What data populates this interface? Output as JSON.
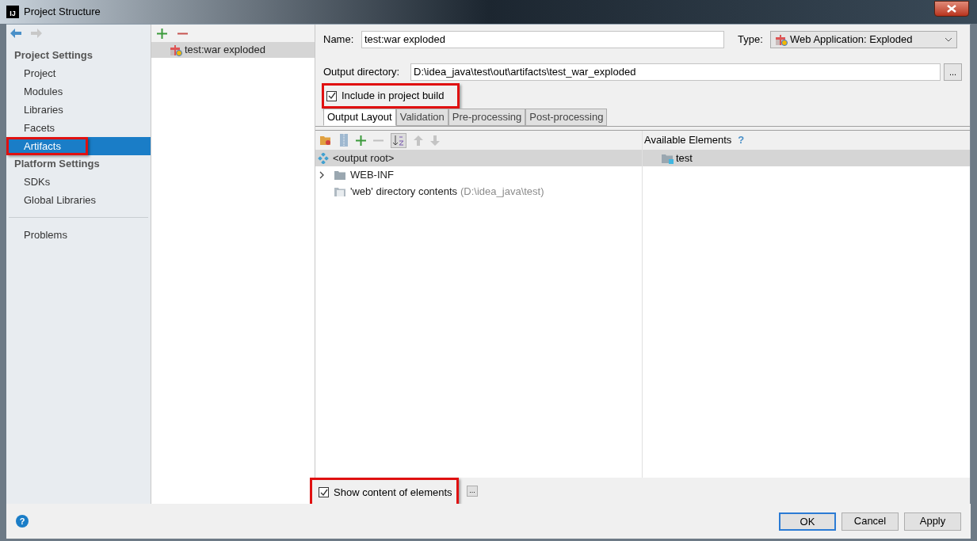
{
  "window": {
    "logo": "IJ",
    "title": "Project Structure"
  },
  "sidebar": {
    "sections": [
      {
        "title": "Project Settings",
        "items": [
          {
            "label": "Project",
            "selected": false,
            "highlighted": false
          },
          {
            "label": "Modules",
            "selected": false,
            "highlighted": false
          },
          {
            "label": "Libraries",
            "selected": false,
            "highlighted": false
          },
          {
            "label": "Facets",
            "selected": false,
            "highlighted": false
          },
          {
            "label": "Artifacts",
            "selected": true,
            "highlighted": true
          }
        ]
      },
      {
        "title": "Platform Settings",
        "items": [
          {
            "label": "SDKs",
            "selected": false,
            "highlighted": false
          },
          {
            "label": "Global Libraries",
            "selected": false,
            "highlighted": false
          }
        ]
      },
      {
        "items": [
          {
            "label": "Problems",
            "selected": false,
            "highlighted": false
          }
        ]
      }
    ]
  },
  "artifacts": [
    {
      "label": "test:war exploded",
      "selected": true
    }
  ],
  "form": {
    "name_label": "Name:",
    "name_value": "test:war exploded",
    "type_label": "Type:",
    "type_value": "Web Application: Exploded",
    "output_label": "Output directory:",
    "output_value": "D:\\idea_java\\test\\out\\artifacts\\test_war_exploded",
    "browse": "...",
    "include": {
      "label": "Include in project build",
      "checked": true,
      "highlighted": true
    }
  },
  "tabs": [
    {
      "label": "Output Layout",
      "selected": true
    },
    {
      "label": "Validation",
      "selected": false
    },
    {
      "label": "Pre-processing",
      "selected": false
    },
    {
      "label": "Post-processing",
      "selected": false
    }
  ],
  "layout_tree": [
    {
      "kind": "root",
      "label": "<output root>",
      "selected": true,
      "children": [
        {
          "kind": "folder",
          "label": "WEB-INF",
          "expanded": false,
          "selected": false
        },
        {
          "kind": "contents",
          "label": "'web' directory contents",
          "detail": "(D:\\idea_java\\test)",
          "selected": false
        }
      ]
    }
  ],
  "available": {
    "title": "Available Elements",
    "help": "?",
    "items": [
      {
        "label": "test",
        "selected": true
      }
    ]
  },
  "show_content": {
    "label": "Show content of elements",
    "checked": true,
    "highlighted": true,
    "more": "..."
  },
  "help": "?",
  "buttons": [
    {
      "label": "OK",
      "default": true
    },
    {
      "label": "Cancel",
      "default": false
    },
    {
      "label": "Apply",
      "default": false
    }
  ]
}
